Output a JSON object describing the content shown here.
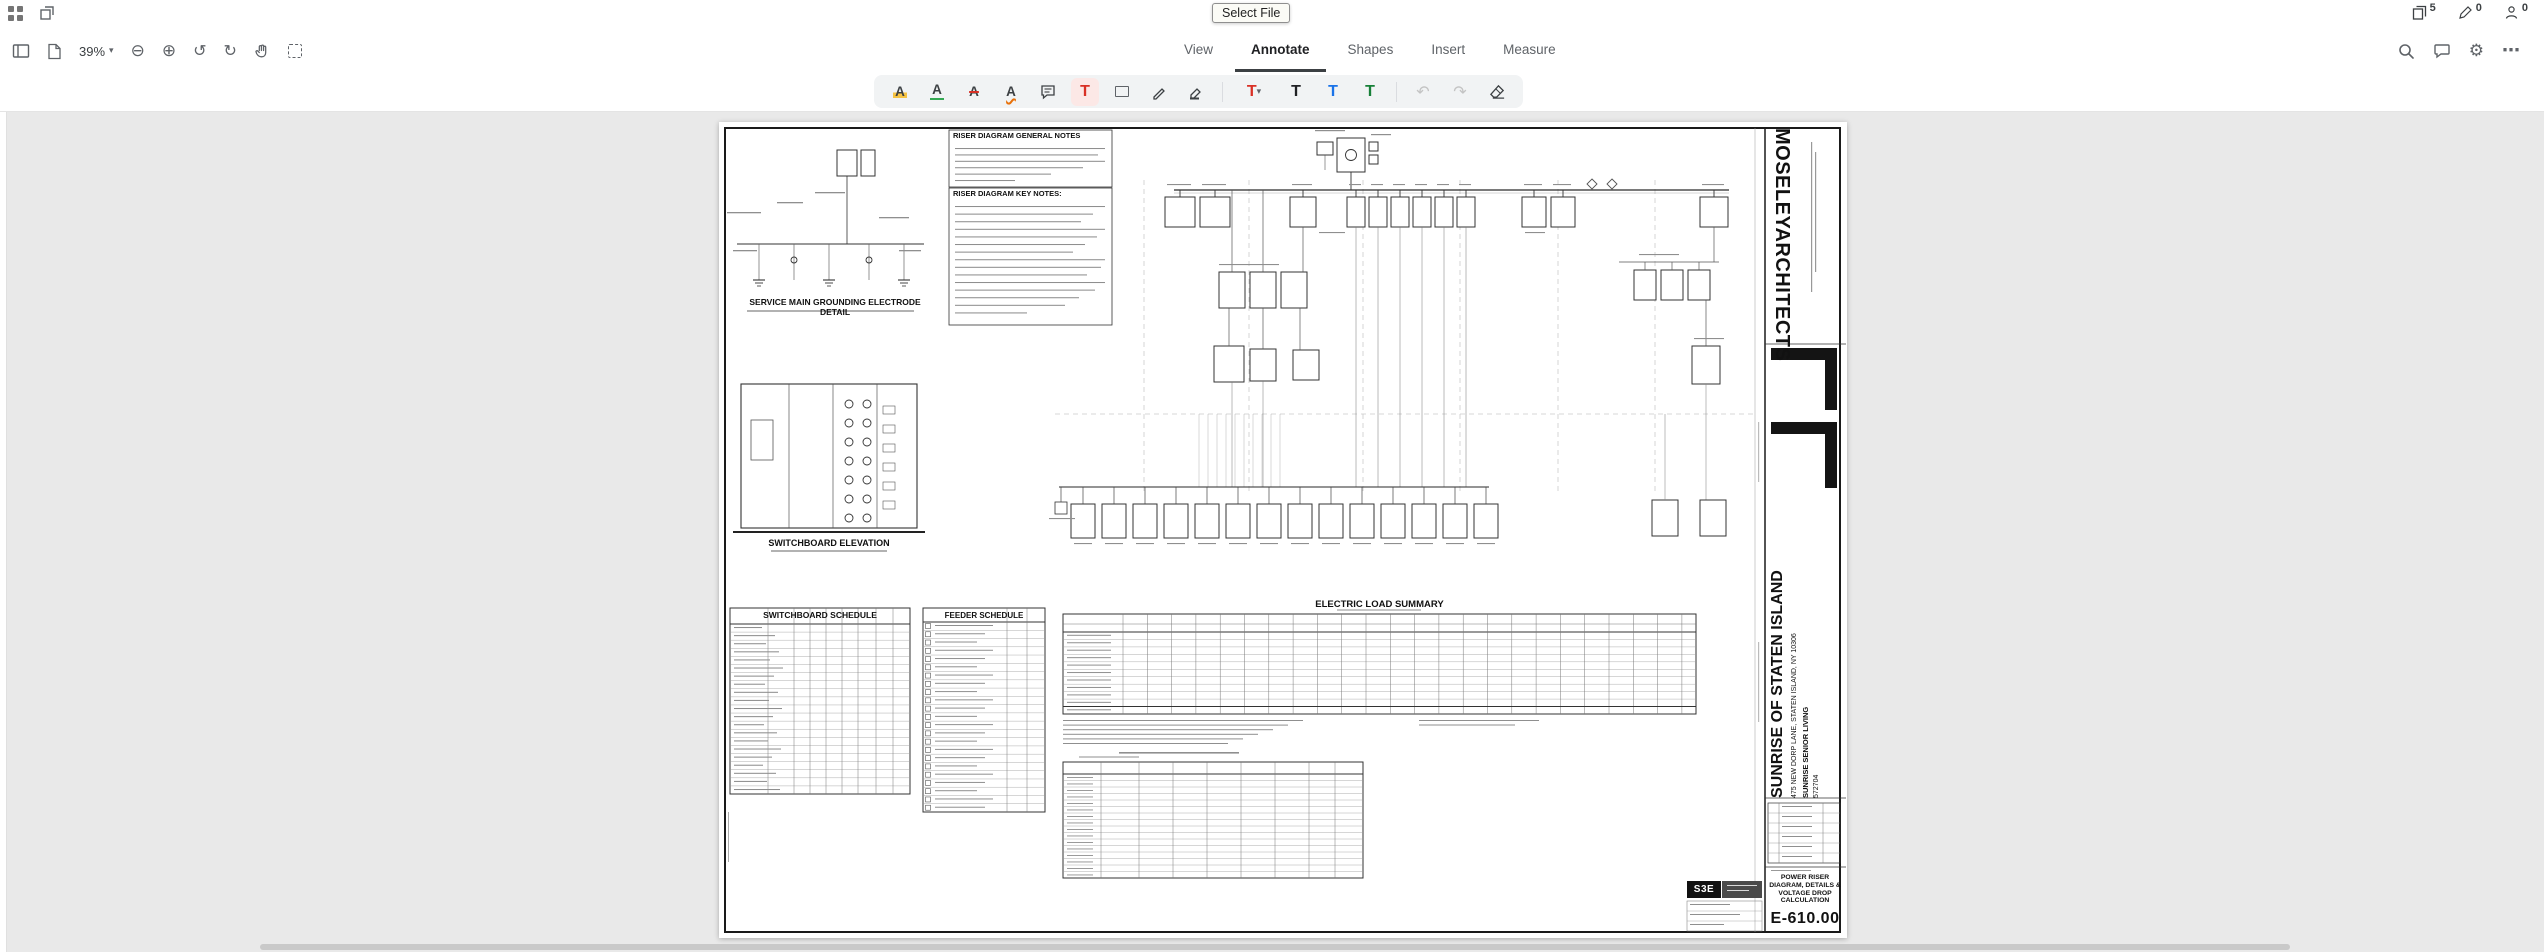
{
  "tooltip": {
    "label": "Select File"
  },
  "status": {
    "page_count": "5",
    "annotation_count": "0",
    "presence_count": "0"
  },
  "toolbar": {
    "zoom_value": "39%",
    "tabs": {
      "view": "View",
      "annotate": "Annotate",
      "shapes": "Shapes",
      "insert": "Insert",
      "measure": "Measure"
    }
  },
  "colors": {
    "selected_tool": "#d93025",
    "text_preset_red": "#d93025",
    "text_preset_black": "#202124",
    "text_preset_blue": "#1a73e8",
    "text_preset_green": "#188038"
  },
  "sheet": {
    "general_notes_title": "RISER DIAGRAM GENERAL NOTES",
    "key_notes_title": "RISER DIAGRAM KEY NOTES:",
    "grounding_detail_title": "SERVICE MAIN GROUNDING ELECTRODE DETAIL",
    "elevation_title": "SWITCHBOARD ELEVATION",
    "switchboard_schedule_title": "SWITCHBOARD SCHEDULE",
    "feeder_schedule_title": "FEEDER SCHEDULE",
    "load_summary_title": "ELECTRIC LOAD SUMMARY",
    "titleblock": {
      "architect": "MOSELEYARCHITECTS",
      "project": "SUNRISE OF STATEN ISLAND",
      "address": "475 NEW DORP LANE, STATEN ISLAND, NY 10306",
      "client": "SUNRISE SENIOR LIVING",
      "project_number": "572704",
      "sheet_title": "POWER RISER DIAGRAM, DETAILS & VOLTAGE DROP CALCULATION",
      "sheet_number": "E-610.00",
      "engineer_logo": "S3E"
    }
  }
}
